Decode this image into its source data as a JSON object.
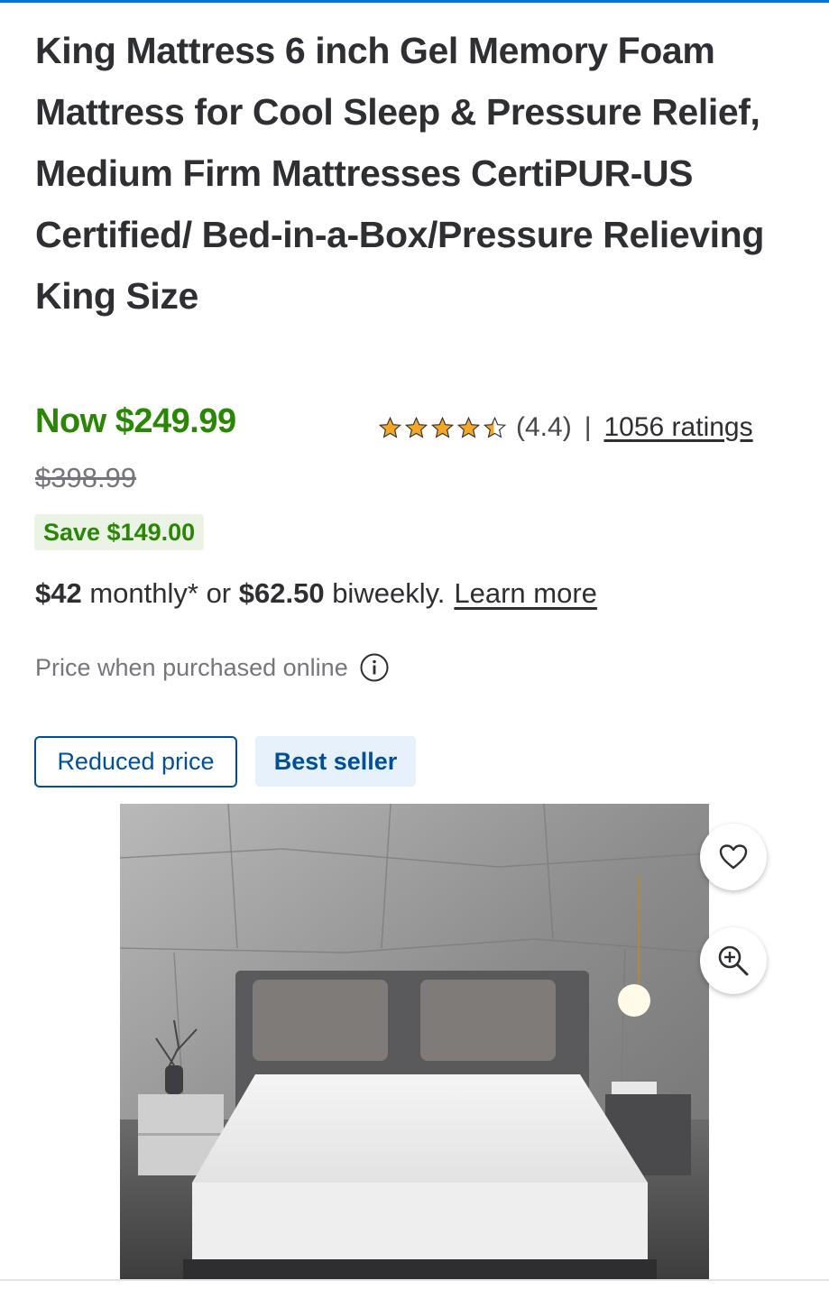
{
  "product": {
    "title": "King Mattress 6 inch Gel Memory Foam Mattress for Cool Sleep & Pressure Relief, Medium Firm Mattresses CertiPUR-US Certified/ Bed-in-a-Box/Pressure Relieving King Size"
  },
  "price": {
    "now": "Now $249.99",
    "was": "$398.99",
    "save": "Save $149.00",
    "now_color": "#2a8703"
  },
  "rating": {
    "stars": 4.4,
    "value_text": "(4.4)",
    "separator": "|",
    "count_link": "1056 ratings",
    "star_color": "#f4a625"
  },
  "financing": {
    "monthly_amount": "$42",
    "monthly_text": " monthly* or ",
    "biweekly_amount": "$62.50",
    "biweekly_text": " biweekly.",
    "learn_more": "Learn more"
  },
  "price_note": {
    "text": "Price when purchased online",
    "icon": "info-icon"
  },
  "badges": {
    "reduced": "Reduced price",
    "best_seller": "Best seller"
  },
  "image_actions": {
    "favorite_icon": "heart-icon",
    "zoom_icon": "zoom-in-icon"
  },
  "colors": {
    "accent_blue": "#004f9a",
    "top_bar": "#0071dc",
    "save_bg": "#eaf3e6",
    "best_seller_bg": "#e6f1fc"
  }
}
